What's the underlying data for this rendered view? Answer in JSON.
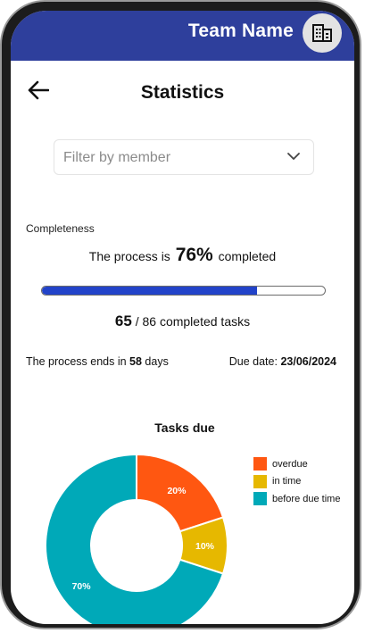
{
  "header": {
    "team_name": "Team Name"
  },
  "page": {
    "title": "Statistics"
  },
  "filter": {
    "placeholder": "Filter by member"
  },
  "completeness": {
    "label": "Completeness",
    "prefix": "The process is",
    "percent": "76%",
    "suffix": "completed",
    "progress_fraction": 0.76
  },
  "tasks": {
    "completed": "65",
    "rest": " / 86 completed tasks"
  },
  "ends": {
    "prefix": "The process ends in ",
    "days": "58",
    "suffix": " days"
  },
  "due": {
    "label": "Due date: ",
    "date": "23/06/2024"
  },
  "colors": {
    "header": "#2e3f9c",
    "progress": "#2243c9"
  },
  "chart_data": {
    "type": "pie",
    "title": "Tasks due",
    "labels": [
      "overdue",
      "in time",
      "before due time"
    ],
    "values": [
      20,
      10,
      70
    ],
    "value_labels": [
      "20%",
      "10%",
      "70%"
    ],
    "colors": [
      "#ff5711",
      "#e6b800",
      "#00a9b8"
    ],
    "legend": "right"
  }
}
